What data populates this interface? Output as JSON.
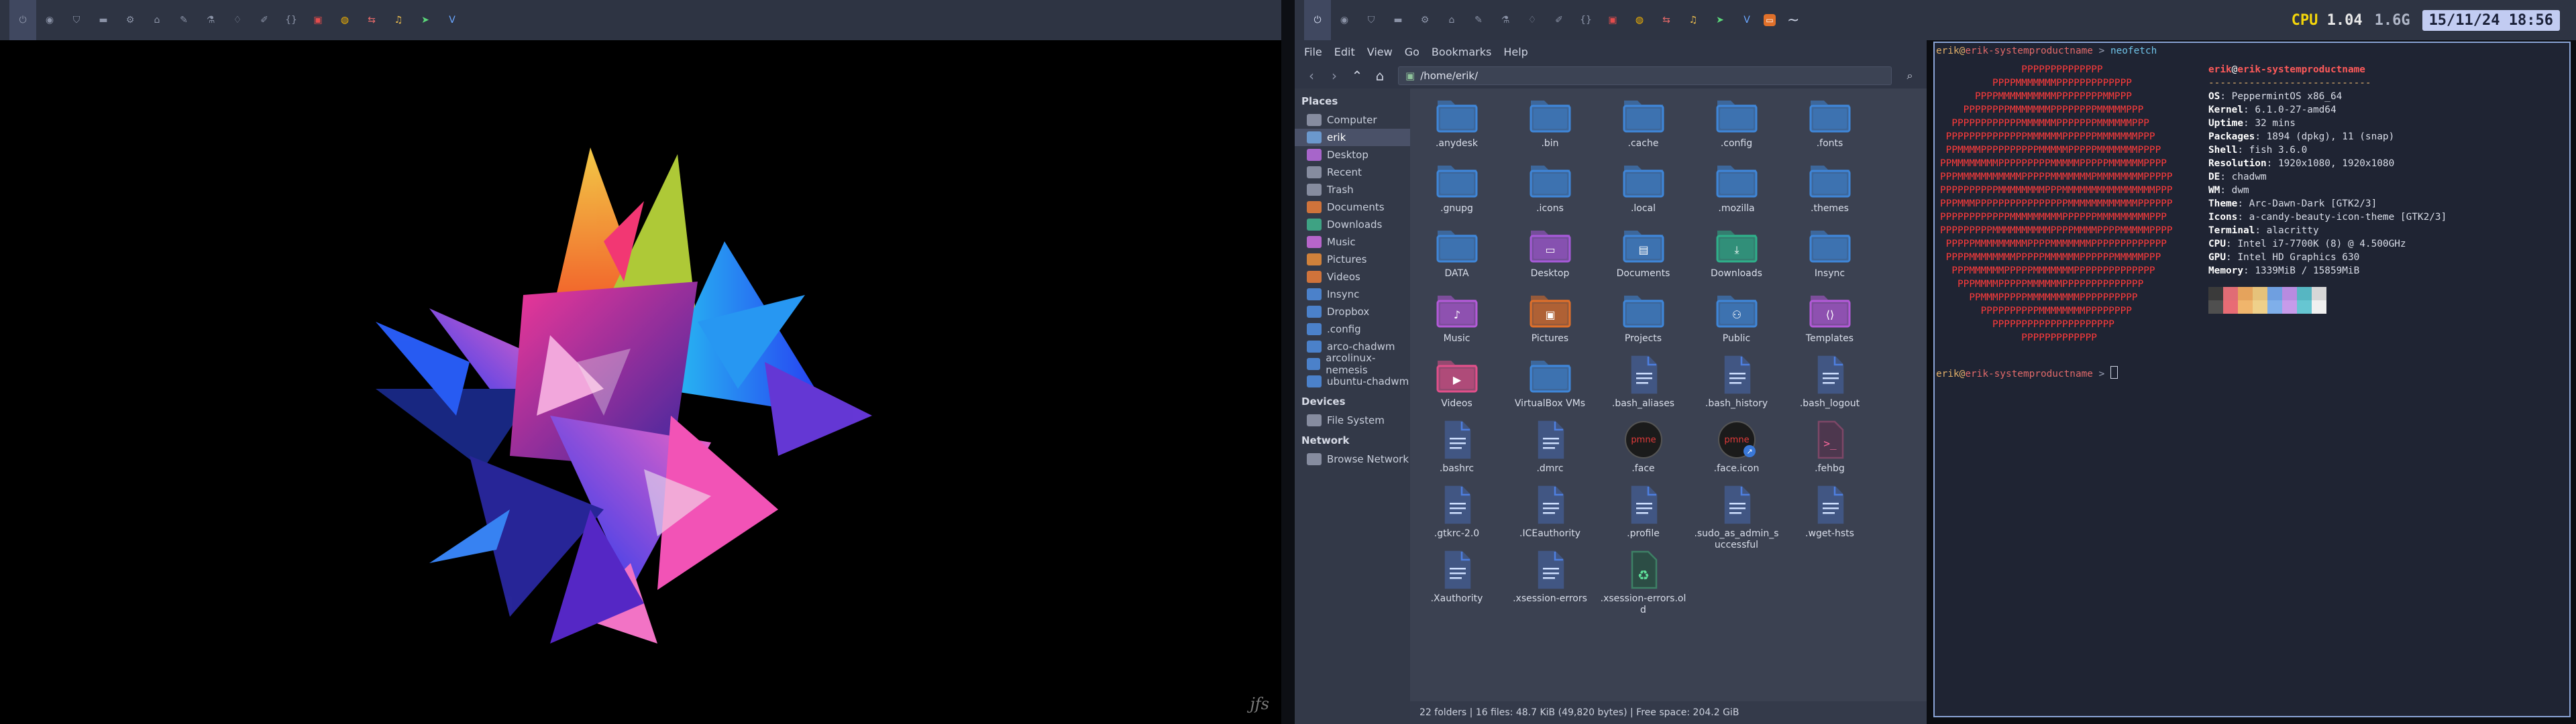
{
  "left_bar": {
    "tags": [
      {
        "icon": "power-icon",
        "glyph": "⏻",
        "color": "#8b93a7",
        "active": true
      },
      {
        "icon": "firefox-icon",
        "glyph": "◉",
        "color": "#8b93a7"
      },
      {
        "icon": "shield-icon",
        "glyph": "⛉",
        "color": "#8b93a7"
      },
      {
        "icon": "inbox-icon",
        "glyph": "▬",
        "color": "#8b93a7"
      },
      {
        "icon": "gear-icon",
        "glyph": "⚙",
        "color": "#8b93a7"
      },
      {
        "icon": "cap-icon",
        "glyph": "⌂",
        "color": "#8b93a7"
      },
      {
        "icon": "wrench-icon",
        "glyph": "✎",
        "color": "#8b93a7"
      },
      {
        "icon": "flask-icon",
        "glyph": "⚗",
        "color": "#8b93a7"
      },
      {
        "icon": "bell-icon",
        "glyph": "♢",
        "color": "#8b93a7"
      },
      {
        "icon": "pencil-icon",
        "glyph": "✐",
        "color": "#8b93a7"
      },
      {
        "icon": "code-icon",
        "glyph": "{}",
        "color": "#8b93a7"
      },
      {
        "icon": "pdf-icon",
        "glyph": "▣",
        "color": "#e44c4c"
      },
      {
        "icon": "chrome-icon",
        "glyph": "◍",
        "color": "#f4b400"
      },
      {
        "icon": "meld-icon",
        "glyph": "⇆",
        "color": "#e86a6a"
      },
      {
        "icon": "music-icon",
        "glyph": "♫",
        "color": "#f2c14e"
      },
      {
        "icon": "telegram-icon",
        "glyph": "➤",
        "color": "#5bd87a"
      },
      {
        "icon": "vivaldi-icon",
        "glyph": "V",
        "color": "#6aa6ff"
      }
    ]
  },
  "right_bar": {
    "tags": [
      {
        "icon": "power-icon",
        "glyph": "⏻",
        "color": "#cfd6ea",
        "active": true
      },
      {
        "icon": "firefox-icon",
        "glyph": "◉",
        "color": "#8b93a7"
      },
      {
        "icon": "shield-icon",
        "glyph": "⛉",
        "color": "#8b93a7"
      },
      {
        "icon": "inbox-icon",
        "glyph": "▬",
        "color": "#8b93a7"
      },
      {
        "icon": "gear-icon",
        "glyph": "⚙",
        "color": "#8b93a7"
      },
      {
        "icon": "cap-icon",
        "glyph": "⌂",
        "color": "#8b93a7"
      },
      {
        "icon": "wrench-icon",
        "glyph": "✎",
        "color": "#8b93a7"
      },
      {
        "icon": "flask-icon",
        "glyph": "⚗",
        "color": "#8b93a7"
      },
      {
        "icon": "bell-icon",
        "glyph": "♢",
        "color": "#8b93a7"
      },
      {
        "icon": "pencil-icon",
        "glyph": "✐",
        "color": "#8b93a7"
      },
      {
        "icon": "code-icon",
        "glyph": "{}",
        "color": "#8b93a7"
      },
      {
        "icon": "pdf-icon",
        "glyph": "▣",
        "color": "#e44c4c"
      },
      {
        "icon": "chrome-icon",
        "glyph": "◍",
        "color": "#f4b400"
      },
      {
        "icon": "meld-icon",
        "glyph": "⇆",
        "color": "#e86a6a"
      },
      {
        "icon": "music-icon",
        "glyph": "♫",
        "color": "#f2c14e"
      },
      {
        "icon": "telegram-icon",
        "glyph": "➤",
        "color": "#5bd87a"
      },
      {
        "icon": "vivaldi-icon",
        "glyph": "V",
        "color": "#6aa6ff"
      }
    ],
    "window_icon": "terminal-icon",
    "window_title": "~",
    "cpu_label": "CPU",
    "cpu_value": "1.04",
    "mem_value": "1.6G",
    "datetime": "15/11/24 18:56"
  },
  "wallpaper": {
    "signature": "jfs"
  },
  "file_manager": {
    "menu": [
      "File",
      "Edit",
      "View",
      "Go",
      "Bookmarks",
      "Help"
    ],
    "path": "/home/erik/",
    "places_header": "Places",
    "places": [
      {
        "label": "Computer",
        "icon": "computer-icon",
        "color": "#8f96a8"
      },
      {
        "label": "erik",
        "icon": "home-folder-icon",
        "color": "#6fa0d8",
        "selected": true
      },
      {
        "label": "Desktop",
        "icon": "desktop-folder-icon",
        "color": "#b46ad8"
      },
      {
        "label": "Recent",
        "icon": "recent-icon",
        "color": "#8f96a8"
      },
      {
        "label": "Trash",
        "icon": "trash-icon",
        "color": "#8f96a8"
      },
      {
        "label": "Documents",
        "icon": "documents-folder-icon",
        "color": "#e07a3a"
      },
      {
        "label": "Downloads",
        "icon": "downloads-folder-icon",
        "color": "#3fae8a"
      },
      {
        "label": "Music",
        "icon": "music-folder-icon",
        "color": "#c46ad8"
      },
      {
        "label": "Pictures",
        "icon": "pictures-folder-icon",
        "color": "#e08a3a"
      },
      {
        "label": "Videos",
        "icon": "videos-folder-icon",
        "color": "#e07a3a"
      },
      {
        "label": "Insync",
        "icon": "folder-icon",
        "color": "#4e8ad8"
      },
      {
        "label": "Dropbox",
        "icon": "folder-icon",
        "color": "#4e8ad8"
      },
      {
        "label": ".config",
        "icon": "folder-icon",
        "color": "#4e8ad8"
      },
      {
        "label": "arco-chadwm",
        "icon": "folder-icon",
        "color": "#4e8ad8"
      },
      {
        "label": "arcolinux-nemesis",
        "icon": "folder-icon",
        "color": "#4e8ad8"
      },
      {
        "label": "ubuntu-chadwm",
        "icon": "folder-icon",
        "color": "#4e8ad8"
      }
    ],
    "devices_header": "Devices",
    "devices": [
      {
        "label": "File System",
        "icon": "drive-icon",
        "color": "#8f96a8"
      }
    ],
    "network_header": "Network",
    "network": [
      {
        "label": "Browse Network",
        "icon": "network-icon",
        "color": "#8f96a8"
      }
    ],
    "items": [
      {
        "name": ".anydesk",
        "kind": "folder"
      },
      {
        "name": ".bin",
        "kind": "folder"
      },
      {
        "name": ".cache",
        "kind": "folder"
      },
      {
        "name": ".config",
        "kind": "folder"
      },
      {
        "name": ".fonts",
        "kind": "folder"
      },
      {
        "name": ".gnupg",
        "kind": "folder"
      },
      {
        "name": ".icons",
        "kind": "folder"
      },
      {
        "name": ".local",
        "kind": "folder"
      },
      {
        "name": ".mozilla",
        "kind": "folder"
      },
      {
        "name": ".themes",
        "kind": "folder"
      },
      {
        "name": "DATA",
        "kind": "folder"
      },
      {
        "name": "Desktop",
        "kind": "folder",
        "color": "#a65ad8",
        "emblem": "▭"
      },
      {
        "name": "Documents",
        "kind": "folder",
        "emblem": "▤"
      },
      {
        "name": "Downloads",
        "kind": "folder",
        "color": "#2fb08a",
        "emblem": "⤓"
      },
      {
        "name": "Insync",
        "kind": "folder"
      },
      {
        "name": "Music",
        "kind": "folder",
        "color": "#b35ad8",
        "emblem": "♪"
      },
      {
        "name": "Pictures",
        "kind": "folder",
        "color": "#e0702a",
        "emblem": "▣"
      },
      {
        "name": "Projects",
        "kind": "folder"
      },
      {
        "name": "Public",
        "kind": "folder",
        "emblem": "⚇"
      },
      {
        "name": "Templates",
        "kind": "folder",
        "color": "#b35ad8",
        "emblem": "⟨⟩"
      },
      {
        "name": "Videos",
        "kind": "folder",
        "color": "#e0508a",
        "emblem": "▶"
      },
      {
        "name": "VirtualBox VMs",
        "kind": "folder"
      },
      {
        "name": ".bash_aliases",
        "kind": "file"
      },
      {
        "name": ".bash_history",
        "kind": "file"
      },
      {
        "name": ".bash_logout",
        "kind": "file"
      },
      {
        "name": ".bashrc",
        "kind": "file"
      },
      {
        "name": ".dmrc",
        "kind": "file"
      },
      {
        "name": ".face",
        "kind": "face"
      },
      {
        "name": ".face.icon",
        "kind": "face-link"
      },
      {
        "name": ".fehbg",
        "kind": "script"
      },
      {
        "name": ".gtkrc-2.0",
        "kind": "file"
      },
      {
        "name": ".ICEauthority",
        "kind": "file"
      },
      {
        "name": ".profile",
        "kind": "file"
      },
      {
        "name": ".sudo_as_admin_successful",
        "kind": "file"
      },
      {
        "name": ".wget-hsts",
        "kind": "file"
      },
      {
        "name": ".Xauthority",
        "kind": "file"
      },
      {
        "name": ".xsession-errors",
        "kind": "file"
      },
      {
        "name": ".xsession-errors.old",
        "kind": "archive"
      }
    ],
    "face_text": "pmne",
    "status": "22 folders  |  16 files: 48.7 KiB (49,820 bytes)  |  Free space: 204.2 GiB"
  },
  "terminal": {
    "prompt_user": "erik",
    "prompt_host": "erik-systemproductname",
    "prompt_arrow": " > ",
    "command": "neofetch",
    "info_user": "erik",
    "info_at": "@",
    "info_host": "erik-systemproductname",
    "separator": "----------------------------",
    "info": [
      {
        "key": "OS",
        "value": "PeppermintOS x86_64"
      },
      {
        "key": "Kernel",
        "value": "6.1.0-27-amd64"
      },
      {
        "key": "Uptime",
        "value": "32 mins"
      },
      {
        "key": "Packages",
        "value": "1894 (dpkg), 11 (snap)"
      },
      {
        "key": "Shell",
        "value": "fish 3.6.0"
      },
      {
        "key": "Resolution",
        "value": "1920x1080, 1920x1080"
      },
      {
        "key": "DE",
        "value": "chadwm"
      },
      {
        "key": "WM",
        "value": "dwm"
      },
      {
        "key": "Theme",
        "value": "Arc-Dawn-Dark [GTK2/3]"
      },
      {
        "key": "Icons",
        "value": "a-candy-beauty-icon-theme [GTK2/3]"
      },
      {
        "key": "Terminal",
        "value": "alacritty"
      },
      {
        "key": "CPU",
        "value": "Intel i7-7700K (8) @ 4.500GHz"
      },
      {
        "key": "GPU",
        "value": "Intel HD Graphics 630"
      },
      {
        "key": "Memory",
        "value": "1339MiB / 15859MiB"
      }
    ],
    "swatches_top": [
      "#3a3a3a",
      "#e06c75",
      "#e5a35c",
      "#e6c27a",
      "#6f9fe0",
      "#b88be0",
      "#56b6c2",
      "#d7d7d7"
    ],
    "swatches_bottom": [
      "#4f4f4f",
      "#e86c75",
      "#f0b56c",
      "#efd08a",
      "#7fafea",
      "#c79bea",
      "#66c6d2",
      "#f0f0f0"
    ],
    "art": [
      "              PPPPPPPPPPPPPP",
      "         PPPPMMMMMMMPPPPPPPPPPPPP",
      "      PPPPMMMMMMMMMMPPPPPPPPMMPPP",
      "    PPPPPPPPMMMMMMMPPPPPPPPMMMMMPPP",
      "  PPPPPPPPPPPPMMMMMMPPPPPPPMMMMMMPPP",
      " PPPPPPPPPPPPPPMMMMMMPPPPPPMMMMMMMPPP",
      " PPMMMMPPPPPPPPPPMMMMMPPPPPMMMMMMMPPPP",
      "PPMMMMMMMMPPPPPPPPPMMMMMPPPPPMMMMMMPPPP",
      "PPPMMMMMMMMMMMPPPPPMMMMMMMPMMMMMMMMPPPPP",
      "PPPPPPPPPPMMMMMMMMPPPMMMMMMMMMMMMMMMMPPP",
      "PPPMMMPPPPPPPPPPPPPPPPMMMMMMMMMMMMPPPPPP",
      "PPPPPPPPPPPPMMMMMMMMMPPPPPPMMMMMMMMMPPP",
      "PPPPPPPPPMMMMMMMMMMPPPPMMMMPPPPMMMMMPPPP",
      " PPPPPMMMMMMMMMPPPPMMMMMMMPPPPPPPPPPPPP",
      " PPPPMMMMMMMMPPPPPMMMMMMPPPPPPMMMMMPPP",
      "  PPPMMMMMMPPPPPMMMMMMMPPPPPPPPPPPPPP",
      "   PPPMMMMPPPPPMMMMMMPPPPPPPPPPPPPP",
      "     PPMMMPPPPPMMMMMMMMMPPPPPPPPPP",
      "       PPPPPPPPPPMMMMMMMMPPPPPPPP",
      "         PPPPPPPPPPPPPPPPPPPPP",
      "              PPPPPPPPPPPPP"
    ]
  }
}
